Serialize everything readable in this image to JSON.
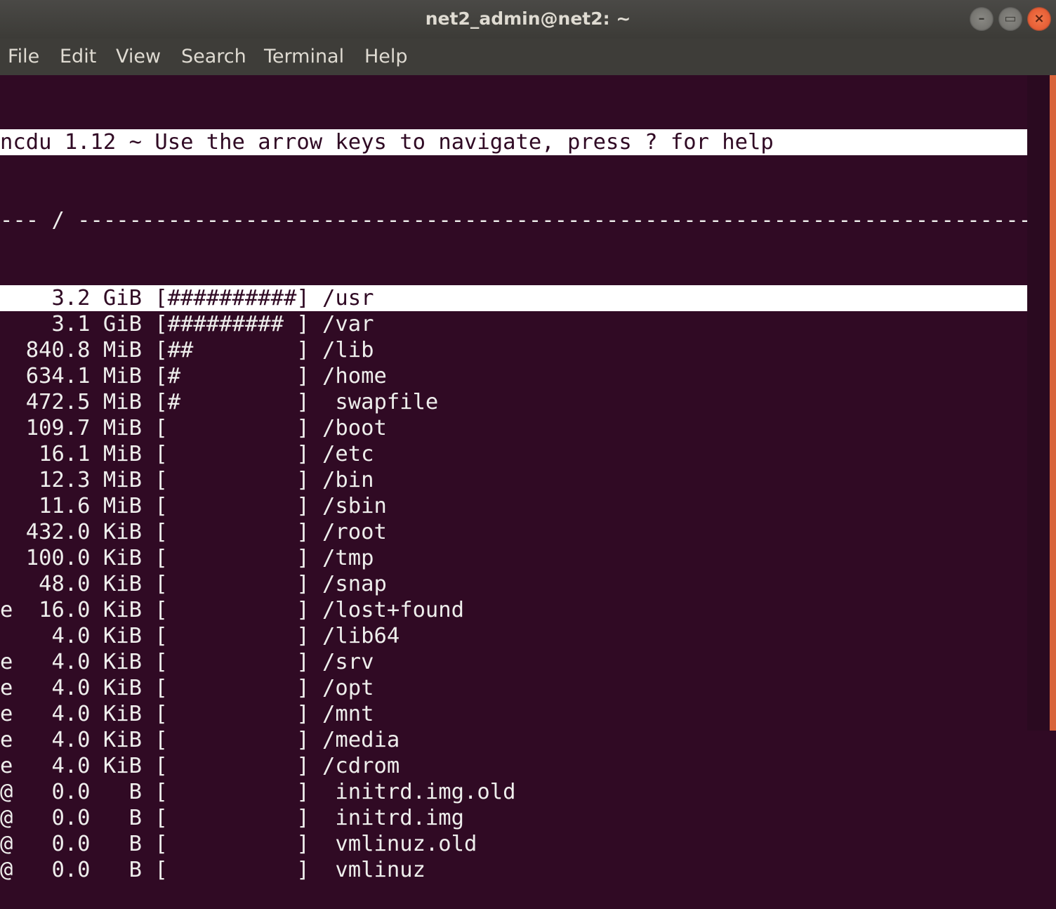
{
  "window": {
    "title": "net2_admin@net2: ~",
    "buttons": [
      "minimize",
      "maximize",
      "close"
    ]
  },
  "menu": [
    "File",
    "Edit",
    "View",
    "Search",
    "Terminal",
    "Help"
  ],
  "terminal": {
    "header": "ncdu 1.12 ~ Use the arrow keys to navigate, press ? for help",
    "separator": "--- / ---------------------------------------------------------------------------",
    "selected_index": 0,
    "rows": [
      {
        "flag": " ",
        "size": "3.2",
        "unit": "GiB",
        "bar": "##########",
        "name": "/usr"
      },
      {
        "flag": " ",
        "size": "3.1",
        "unit": "GiB",
        "bar": "######### ",
        "name": "/var"
      },
      {
        "flag": " ",
        "size": "840.8",
        "unit": "MiB",
        "bar": "##        ",
        "name": "/lib"
      },
      {
        "flag": " ",
        "size": "634.1",
        "unit": "MiB",
        "bar": "#         ",
        "name": "/home"
      },
      {
        "flag": " ",
        "size": "472.5",
        "unit": "MiB",
        "bar": "#         ",
        "name": " swapfile"
      },
      {
        "flag": " ",
        "size": "109.7",
        "unit": "MiB",
        "bar": "          ",
        "name": "/boot"
      },
      {
        "flag": " ",
        "size": "16.1",
        "unit": "MiB",
        "bar": "          ",
        "name": "/etc"
      },
      {
        "flag": " ",
        "size": "12.3",
        "unit": "MiB",
        "bar": "          ",
        "name": "/bin"
      },
      {
        "flag": " ",
        "size": "11.6",
        "unit": "MiB",
        "bar": "          ",
        "name": "/sbin"
      },
      {
        "flag": " ",
        "size": "432.0",
        "unit": "KiB",
        "bar": "          ",
        "name": "/root"
      },
      {
        "flag": " ",
        "size": "100.0",
        "unit": "KiB",
        "bar": "          ",
        "name": "/tmp"
      },
      {
        "flag": " ",
        "size": "48.0",
        "unit": "KiB",
        "bar": "          ",
        "name": "/snap"
      },
      {
        "flag": "e",
        "size": "16.0",
        "unit": "KiB",
        "bar": "          ",
        "name": "/lost+found"
      },
      {
        "flag": " ",
        "size": "4.0",
        "unit": "KiB",
        "bar": "          ",
        "name": "/lib64"
      },
      {
        "flag": "e",
        "size": "4.0",
        "unit": "KiB",
        "bar": "          ",
        "name": "/srv"
      },
      {
        "flag": "e",
        "size": "4.0",
        "unit": "KiB",
        "bar": "          ",
        "name": "/opt"
      },
      {
        "flag": "e",
        "size": "4.0",
        "unit": "KiB",
        "bar": "          ",
        "name": "/mnt"
      },
      {
        "flag": "e",
        "size": "4.0",
        "unit": "KiB",
        "bar": "          ",
        "name": "/media"
      },
      {
        "flag": "e",
        "size": "4.0",
        "unit": "KiB",
        "bar": "          ",
        "name": "/cdrom"
      },
      {
        "flag": "@",
        "size": "0.0",
        "unit": "B",
        "bar": "          ",
        "name": " initrd.img.old"
      },
      {
        "flag": "@",
        "size": "0.0",
        "unit": "B",
        "bar": "          ",
        "name": " initrd.img"
      },
      {
        "flag": "@",
        "size": "0.0",
        "unit": "B",
        "bar": "          ",
        "name": " vmlinuz.old"
      },
      {
        "flag": "@",
        "size": "0.0",
        "unit": "B",
        "bar": "          ",
        "name": " vmlinuz"
      }
    ]
  },
  "colors": {
    "terminal_bg": "#300a24",
    "close_button": "#e0502a"
  }
}
